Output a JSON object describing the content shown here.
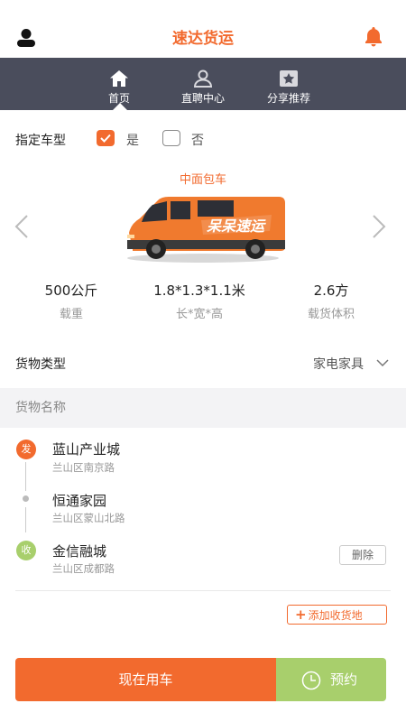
{
  "header": {
    "title": "速达货运",
    "user_icon": "user-icon",
    "bell_icon": "bell-icon",
    "accent": "#f26a2e"
  },
  "nav": {
    "background": "#4a4d5c",
    "tabs": [
      {
        "label": "首页",
        "icon": "home-icon",
        "active": true
      },
      {
        "label": "直聘中心",
        "icon": "person-icon",
        "active": false
      },
      {
        "label": "分享推荐",
        "icon": "star-card-icon",
        "active": false
      }
    ]
  },
  "vehicle_spec": {
    "label": "指定车型",
    "yes_label": "是",
    "no_label": "否",
    "yes_checked": true,
    "no_checked": false
  },
  "vehicle": {
    "name": "中面包车",
    "van_text": "呆呆速运",
    "stats": [
      {
        "value": "500公斤",
        "label": "载重"
      },
      {
        "value": "1.8*1.3*1.1米",
        "label": "长*宽*高"
      },
      {
        "value": "2.6方",
        "label": "载货体积"
      }
    ]
  },
  "cargo": {
    "type_label": "货物类型",
    "type_value": "家电家具",
    "name_placeholder": "货物名称"
  },
  "route": {
    "stops": [
      {
        "badge": "发",
        "badge_color": "#f26a2e",
        "name": "蓝山产业城",
        "address": "兰山区南京路"
      },
      {
        "badge": "",
        "badge_color": "#bbbbbb",
        "name": "恒通家园",
        "address": "兰山区蒙山北路"
      },
      {
        "badge": "收",
        "badge_color": "#a8cf6c",
        "name": "金信融城",
        "address": "兰山区成都路"
      }
    ],
    "delete_label": "删除",
    "add_label": "添加收货地"
  },
  "actions": {
    "now_label": "现在用车",
    "book_label": "预约",
    "now_color": "#f26a2e",
    "book_color": "#a8cf6c"
  }
}
